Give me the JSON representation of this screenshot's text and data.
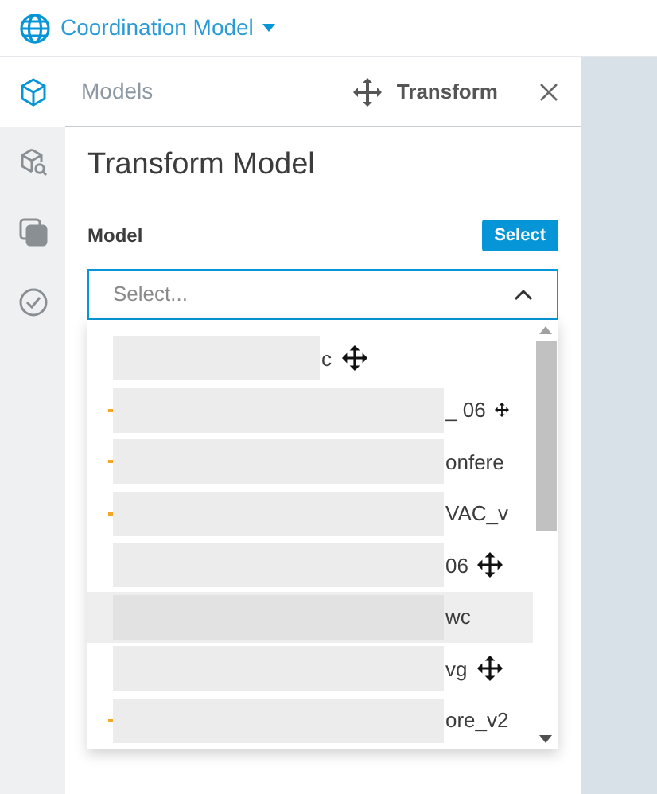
{
  "header": {
    "title": "Coordination Model"
  },
  "rail": [
    {
      "kind": "cube",
      "selected": true
    },
    {
      "kind": "search-cube",
      "selected": false
    },
    {
      "kind": "layers",
      "selected": false
    },
    {
      "kind": "check",
      "selected": false
    }
  ],
  "panel": {
    "tab": "Models",
    "action": "Transform",
    "heading": "Transform Model",
    "field_label": "Model",
    "select_button": "Select",
    "placeholder": "Select...",
    "options": [
      {
        "kind": "movable",
        "text": "c",
        "file_mark": false,
        "hovered": false
      },
      {
        "kind": "mini",
        "text": "_ 06",
        "file_mark": true,
        "hovered": false
      },
      {
        "kind": "plain",
        "text": "onfere",
        "file_mark": true,
        "hovered": false
      },
      {
        "kind": "plain",
        "text": "VAC_v",
        "file_mark": true,
        "hovered": false
      },
      {
        "kind": "movable",
        "text": "06",
        "file_mark": false,
        "hovered": false
      },
      {
        "kind": "plain",
        "text": "wc",
        "file_mark": false,
        "hovered": true
      },
      {
        "kind": "movable",
        "text": "vg",
        "file_mark": false,
        "hovered": false
      },
      {
        "kind": "plain",
        "text": "ore_v2",
        "file_mark": true,
        "hovered": false
      }
    ]
  }
}
